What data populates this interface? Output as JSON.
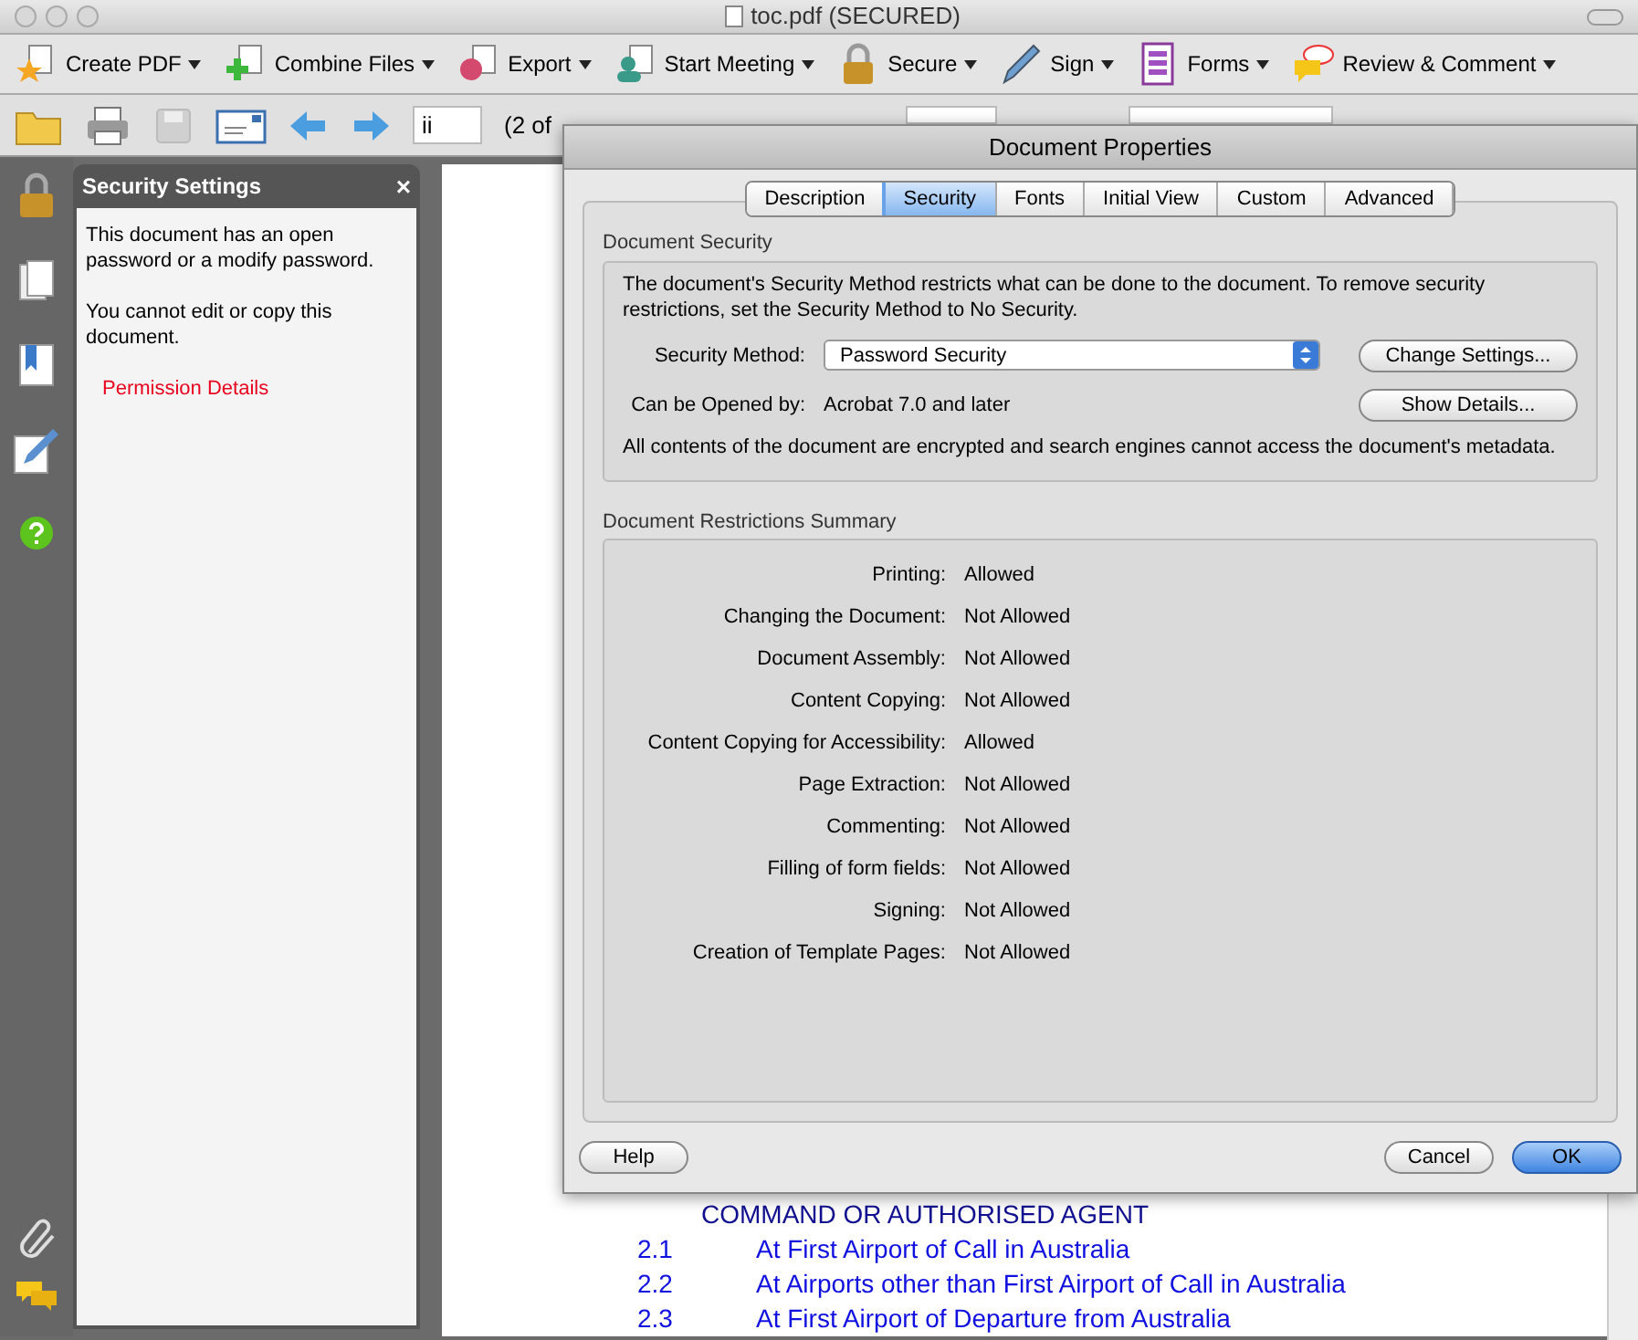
{
  "window": {
    "title": "toc.pdf (SECURED)"
  },
  "toolbar": [
    {
      "label": "Create PDF",
      "kind": "star"
    },
    {
      "label": "Combine Files",
      "kind": "plus"
    },
    {
      "label": "Export",
      "kind": "export"
    },
    {
      "label": "Start Meeting",
      "kind": "person"
    },
    {
      "label": "Secure",
      "kind": "lock"
    },
    {
      "label": "Sign",
      "kind": "pen"
    },
    {
      "label": "Forms",
      "kind": "form"
    },
    {
      "label": "Review & Comment",
      "kind": "comment"
    }
  ],
  "nav": {
    "page_field": "ii",
    "page_count": "(2 of"
  },
  "panel": {
    "title": "Security Settings",
    "close": "×",
    "paragraphs": [
      "This document has an open password or a modify password.",
      "You cannot edit or copy this document."
    ],
    "link": "Permission Details"
  },
  "document": {
    "heading": "COMMAND OR AUTHORISED AGENT",
    "entries": [
      {
        "number": "2.1",
        "text": "At First Airport of Call in Australia"
      },
      {
        "number": "2.2",
        "text": "At Airports other than First Airport of Call in Australia"
      },
      {
        "number": "2.3",
        "text": "At First Airport of Departure from Australia"
      }
    ]
  },
  "dialog": {
    "title": "Document Properties",
    "tabs": [
      {
        "label": "Description",
        "selected": false
      },
      {
        "label": "Security",
        "selected": true
      },
      {
        "label": "Fonts",
        "selected": false
      },
      {
        "label": "Initial View",
        "selected": false
      },
      {
        "label": "Custom",
        "selected": false
      },
      {
        "label": "Advanced",
        "selected": false
      }
    ],
    "security": {
      "heading": "Document Security",
      "intro": "The document's Security Method restricts what can be done to the document. To remove security restrictions, set the Security Method to No Security.",
      "method_label": "Security Method:",
      "method_value": "Password Security",
      "change_button": "Change Settings...",
      "opened_label": "Can be Opened by:",
      "opened_value": "Acrobat 7.0 and later",
      "details_button": "Show Details...",
      "note": "All contents of the document are encrypted and search engines cannot access the document's metadata."
    },
    "restrictions": {
      "heading": "Document Restrictions Summary",
      "rows": [
        {
          "label": "Printing:",
          "value": "Allowed"
        },
        {
          "label": "Changing the Document:",
          "value": "Not Allowed"
        },
        {
          "label": "Document Assembly:",
          "value": "Not Allowed"
        },
        {
          "label": "Content Copying:",
          "value": "Not Allowed"
        },
        {
          "label": "Content Copying for Accessibility:",
          "value": "Allowed"
        },
        {
          "label": "Page Extraction:",
          "value": "Not Allowed"
        },
        {
          "label": "Commenting:",
          "value": "Not Allowed"
        },
        {
          "label": "Filling of form fields:",
          "value": "Not Allowed"
        },
        {
          "label": "Signing:",
          "value": "Not Allowed"
        },
        {
          "label": "Creation of Template Pages:",
          "value": "Not Allowed"
        }
      ]
    },
    "buttons": {
      "help": "Help",
      "cancel": "Cancel",
      "ok": "OK"
    }
  }
}
